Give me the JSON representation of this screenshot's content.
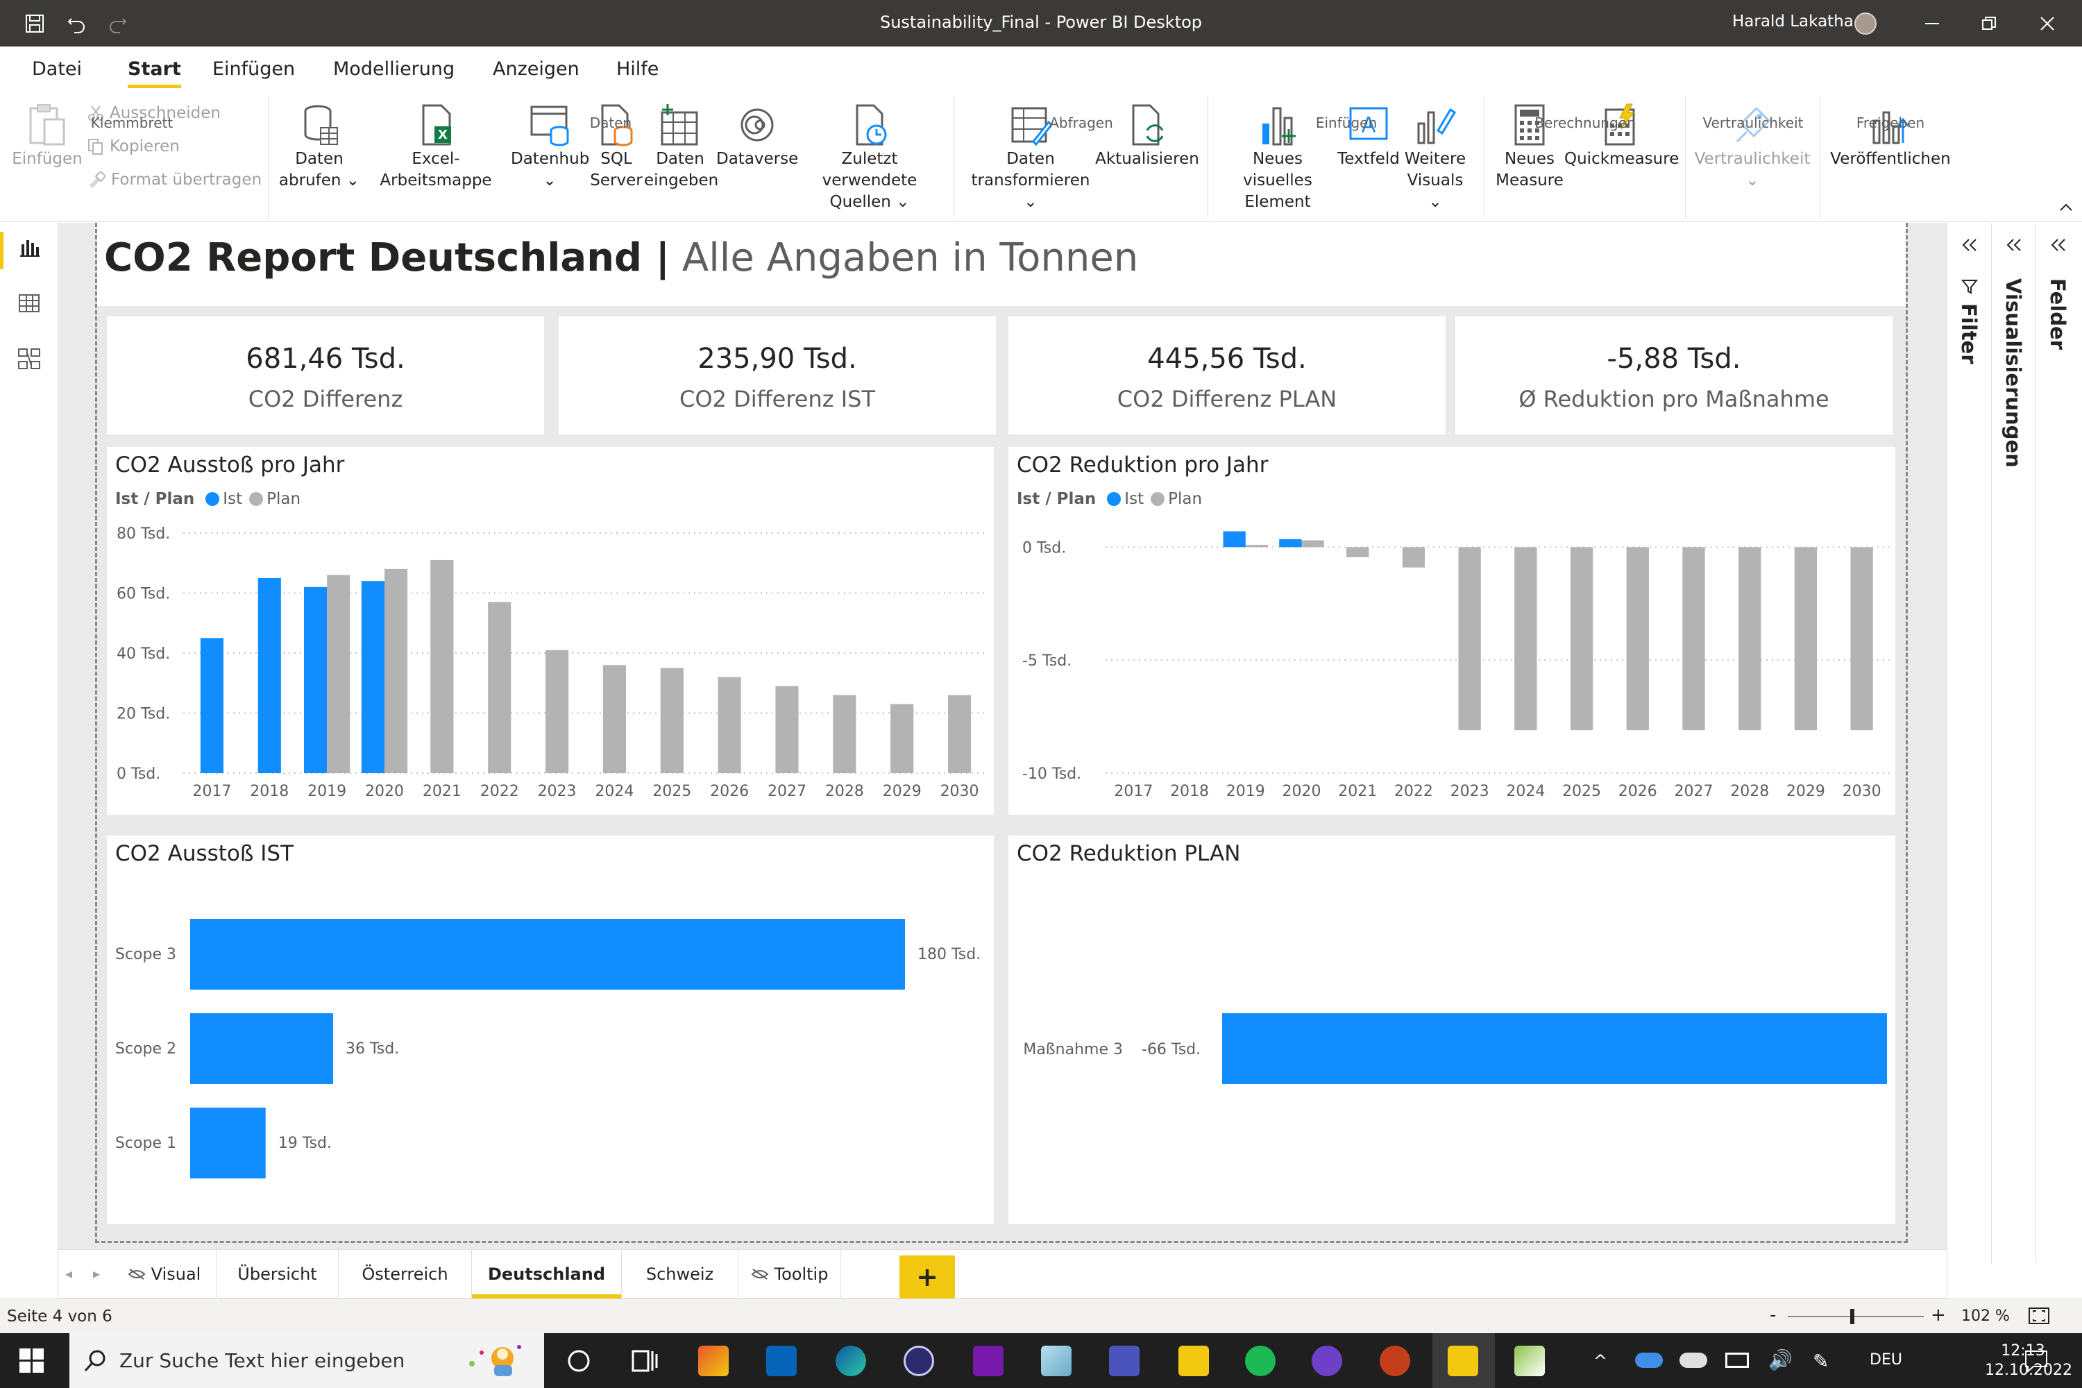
{
  "window": {
    "title": "Sustainability_Final - Power BI Desktop",
    "user": "Harald Lakatha"
  },
  "menu": [
    "Datei",
    "Start",
    "Einfügen",
    "Modellierung",
    "Anzeigen",
    "Hilfe"
  ],
  "ribbon": {
    "clipboard": {
      "paste": "Einfügen",
      "cut": "Ausschneiden",
      "copy": "Kopieren",
      "format": "Format übertragen",
      "group": "Klemmbrett"
    },
    "data": {
      "get_line1": "Daten",
      "get_line2": "abrufen",
      "excel": "Excel-Arbeitsmappe",
      "hub": "Datenhub",
      "sql_line1": "SQL",
      "sql_line2": "Server",
      "enter_line1": "Daten",
      "enter_line2": "eingeben",
      "dataverse": "Dataverse",
      "recent_line1": "Zuletzt verwendete",
      "recent_line2": "Quellen",
      "group": "Daten"
    },
    "queries": {
      "transform_line1": "Daten",
      "transform_line2": "transformieren",
      "refresh": "Aktualisieren",
      "group": "Abfragen"
    },
    "insert": {
      "newvisual_line1": "Neues visuelles",
      "newvisual_line2": "Element",
      "textbox": "Textfeld",
      "more_line1": "Weitere",
      "more_line2": "Visuals",
      "group": "Einfügen"
    },
    "calc": {
      "measure_line1": "Neues",
      "measure_line2": "Measure",
      "quick": "Quickmeasure",
      "group": "Berechnungen"
    },
    "sensitivity": {
      "label": "Vertraulichkeit",
      "group": "Vertraulichkeit"
    },
    "share": {
      "publish": "Veröffentlichen",
      "group": "Freigeben"
    }
  },
  "report": {
    "title_bold": "CO2 Report Deutschland |",
    "title_rest": " Alle Angaben in Tonnen",
    "kpis": [
      {
        "value": "681,46 Tsd.",
        "label": "CO2 Differenz"
      },
      {
        "value": "235,90 Tsd.",
        "label": "CO2 Differenz IST"
      },
      {
        "value": "445,56 Tsd.",
        "label": "CO2 Differenz PLAN"
      },
      {
        "value": "-5,88 Tsd.",
        "label": "Ø Reduktion pro Maßnahme"
      }
    ],
    "legend": {
      "title": "Ist / Plan",
      "ist": "Ist",
      "plan": "Plan"
    }
  },
  "colors": {
    "ist": "#118dff",
    "plan": "#b3b3b3",
    "accent": "#f2c811"
  },
  "chart_data": [
    {
      "type": "bar",
      "title": "CO2 Ausstoß pro Jahr",
      "categories": [
        "2017",
        "2018",
        "2019",
        "2020",
        "2021",
        "2022",
        "2023",
        "2024",
        "2025",
        "2026",
        "2027",
        "2028",
        "2029",
        "2030"
      ],
      "y_ticks": [
        {
          "value": 0,
          "label": "0 Tsd."
        },
        {
          "value": 20,
          "label": "20 Tsd."
        },
        {
          "value": 40,
          "label": "40 Tsd."
        },
        {
          "value": 60,
          "label": "60 Tsd."
        },
        {
          "value": 80,
          "label": "80 Tsd."
        }
      ],
      "ylim": [
        0,
        80
      ],
      "grid": true,
      "legend_position": "top-left",
      "series": [
        {
          "name": "Ist",
          "values": [
            45,
            65,
            62,
            64,
            null,
            null,
            null,
            null,
            null,
            null,
            null,
            null,
            null,
            null
          ]
        },
        {
          "name": "Plan",
          "values": [
            null,
            null,
            66,
            68,
            71,
            57,
            41,
            36,
            35,
            32,
            29,
            26,
            23,
            26
          ]
        }
      ]
    },
    {
      "type": "bar",
      "title": "CO2 Reduktion pro Jahr",
      "categories": [
        "2017",
        "2018",
        "2019",
        "2020",
        "2021",
        "2022",
        "2023",
        "2024",
        "2025",
        "2026",
        "2027",
        "2028",
        "2029",
        "2030"
      ],
      "y_ticks": [
        {
          "value": 0,
          "label": "0 Tsd."
        },
        {
          "value": -5,
          "label": "-5 Tsd."
        },
        {
          "value": -10,
          "label": "-10 Tsd."
        }
      ],
      "ylim": [
        -10,
        1.3
      ],
      "grid": true,
      "legend_position": "top-left",
      "series": [
        {
          "name": "Ist",
          "values": [
            null,
            null,
            0.7,
            0.35,
            null,
            null,
            null,
            null,
            null,
            null,
            null,
            null,
            null,
            null
          ]
        },
        {
          "name": "Plan",
          "values": [
            null,
            null,
            0.1,
            0.3,
            -0.45,
            -0.9,
            -8.1,
            -8.1,
            -8.1,
            -8.1,
            -8.1,
            -8.1,
            -8.1,
            -8.1
          ]
        }
      ]
    },
    {
      "type": "bar",
      "orientation": "horizontal",
      "title": "CO2 Ausstoß IST",
      "categories": [
        "Scope 3",
        "Scope 2",
        "Scope 1"
      ],
      "values": [
        180,
        36,
        19
      ],
      "data_labels": [
        "180 Tsd.",
        "36 Tsd.",
        "19 Tsd."
      ],
      "xlim": [
        0,
        185
      ]
    },
    {
      "type": "bar",
      "orientation": "horizontal",
      "title": "CO2 Reduktion PLAN",
      "categories": [
        "Maßnahme 3"
      ],
      "values": [
        -66
      ],
      "data_labels": [
        "-66 Tsd."
      ]
    }
  ],
  "tabs": [
    {
      "label": "Visual",
      "hidden": true
    },
    {
      "label": "Übersicht"
    },
    {
      "label": "Österreich"
    },
    {
      "label": "Deutschland",
      "active": true
    },
    {
      "label": "Schweiz"
    },
    {
      "label": "Tooltip",
      "hidden": true
    }
  ],
  "add_tab": "+",
  "panes": {
    "filter": "Filter",
    "visualizations": "Visualisierungen",
    "fields": "Felder"
  },
  "status": {
    "page": "Seite 4 von 6",
    "zoom": "102 %",
    "zoom_minus": "-",
    "zoom_plus": "+"
  },
  "taskbar": {
    "search_placeholder": "Zur Suche Text hier eingeben",
    "lang": "DEU",
    "time": "12:13",
    "date": "12.10.2022"
  }
}
